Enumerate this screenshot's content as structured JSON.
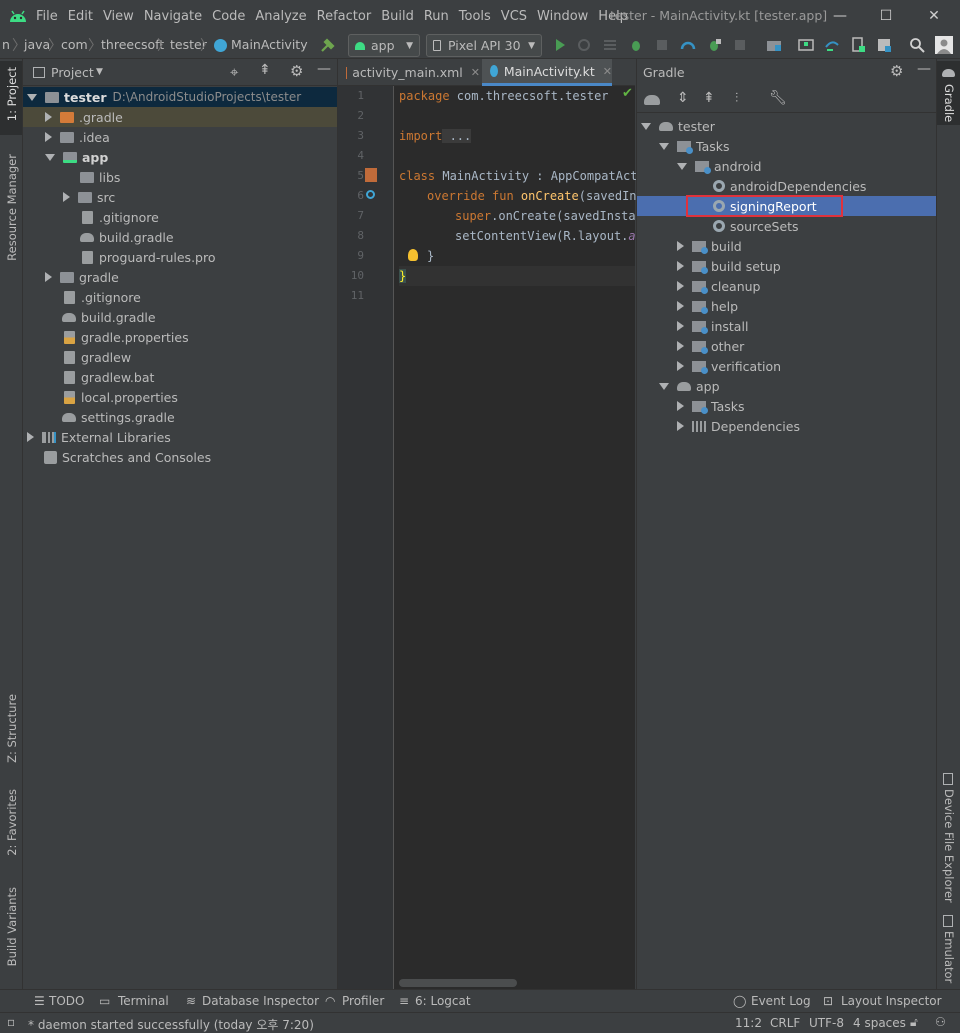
{
  "menu": [
    "File",
    "Edit",
    "View",
    "Navigate",
    "Code",
    "Analyze",
    "Refactor",
    "Build",
    "Run",
    "Tools",
    "VCS",
    "Window",
    "Help"
  ],
  "window_title": "tester - MainActivity.kt [tester.app]",
  "breadcrumb": [
    "n",
    "java",
    "com",
    "threecsoft",
    "tester",
    "MainActivity"
  ],
  "run_config": "app",
  "device": "Pixel API 30",
  "left_stripe": {
    "project": "1: Project",
    "resource_manager": "Resource Manager",
    "structure": "Z: Structure",
    "favorites": "2: Favorites",
    "build_variants": "Build Variants"
  },
  "project": {
    "header": "Project",
    "root_name": "tester",
    "root_path": "D:\\AndroidStudioProjects\\tester",
    "items": [
      ".gradle",
      ".idea",
      "app",
      "libs",
      "src",
      ".gitignore",
      "build.gradle",
      "proguard-rules.pro",
      "gradle",
      ".gitignore",
      "build.gradle",
      "gradle.properties",
      "gradlew",
      "gradlew.bat",
      "local.properties",
      "settings.gradle",
      "External Libraries",
      "Scratches and Consoles"
    ]
  },
  "editor": {
    "tabs": [
      "activity_main.xml",
      "MainActivity.kt"
    ],
    "line_numbers": [
      "1",
      "2",
      "3",
      "4",
      "5",
      "6",
      "7",
      "8",
      "9",
      "10",
      "11"
    ],
    "lines": {
      "l1_kw": "package",
      "l1_rest": " com.threecsoft.tester",
      "l3_kw": "import",
      "l3_rest": " ...",
      "l6_kw": "class",
      "l6_rest": " MainActivity : AppCompatActi",
      "l7_kw": "override fun",
      "l7_fn": " onCreate",
      "l7_rest": "(savedIns",
      "l8_kw": "super",
      "l8_rest": ".onCreate(savedInstar",
      "l9_rest": "setContentView(R.layout.",
      "l9_it": "ac",
      "l10": "}",
      "l11": "}"
    }
  },
  "gradle": {
    "header": "Gradle",
    "tree": {
      "root": "tester",
      "tasks": "Tasks",
      "android": "android",
      "android_dependencies": "androidDependencies",
      "signing_report": "signingReport",
      "source_sets": "sourceSets",
      "build": "build",
      "build_setup": "build setup",
      "cleanup": "cleanup",
      "help": "help",
      "install": "install",
      "other": "other",
      "verification": "verification",
      "app": "app",
      "app_tasks": "Tasks",
      "app_dependencies": "Dependencies"
    }
  },
  "right_stripe": {
    "gradle": "Gradle",
    "device_file_explorer": "Device File Explorer",
    "emulator": "Emulator"
  },
  "bottom_tools": {
    "todo": "TODO",
    "terminal": "Terminal",
    "database_inspector": "Database Inspector",
    "profiler": "Profiler",
    "logcat": "6: Logcat",
    "event_log": "Event Log",
    "layout_inspector": "Layout Inspector"
  },
  "status": {
    "message": "* daemon started successfully (today 오후 7:20)",
    "position": "11:2",
    "line_ending": "CRLF",
    "encoding": "UTF-8",
    "indent": "4 spaces"
  },
  "colors": {
    "selection": "#4b6eaf",
    "highlight_border": "#e0323c",
    "accent_green": "#499c54"
  }
}
